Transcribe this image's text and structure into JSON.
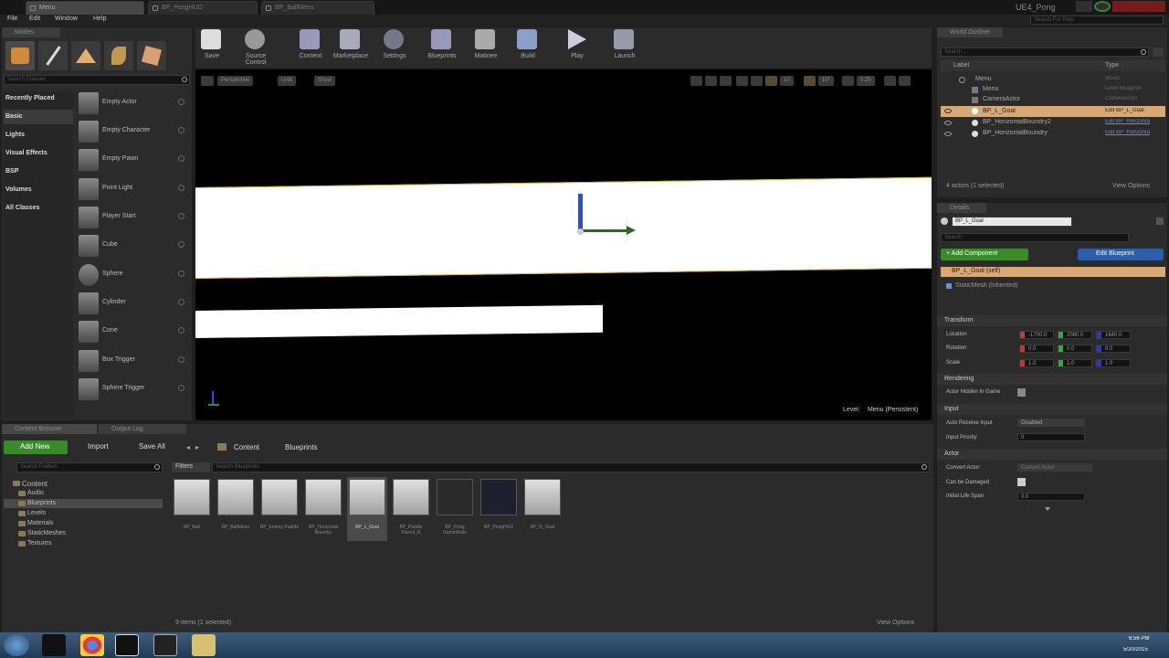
{
  "window": {
    "tabs": [
      "Menu",
      "BP_PongHUD",
      "BP_BallMenu"
    ],
    "app_name": "UE4_Pong",
    "help_placeholder": "Search For Help"
  },
  "menubar": [
    "File",
    "Edit",
    "Window",
    "Help"
  ],
  "modes": {
    "title": "Modes",
    "search_placeholder": "Search Classes",
    "categories": [
      "Recently Placed",
      "Basic",
      "Lights",
      "Visual Effects",
      "BSP",
      "Volumes",
      "All Classes"
    ],
    "items": [
      "Empty Actor",
      "Empty Character",
      "Empty Pawn",
      "Point Light",
      "Player Start",
      "Cube",
      "Sphere",
      "Cylinder",
      "Cone",
      "Box Trigger",
      "Sphere Trigger"
    ]
  },
  "toolbar": [
    "Save",
    "Source Control",
    "Content",
    "Marketplace",
    "Settings",
    "Blueprints",
    "Matinee",
    "Build",
    "Play",
    "Launch"
  ],
  "viewport": {
    "buttons": [
      "Perspective",
      "Unlit",
      "Show"
    ],
    "snap_values": [
      "10",
      "10°",
      "0.25"
    ],
    "level_label": "Level:",
    "level_name": "Menu (Persistent)"
  },
  "world_outliner": {
    "title": "World Outliner",
    "search_placeholder": "Search...",
    "col_label": "Label",
    "col_type": "Type",
    "rows": [
      {
        "label": "Menu",
        "type": "World"
      },
      {
        "label": "Menu",
        "type": "Level Blueprint"
      },
      {
        "label": "CameraActor",
        "type": "CameraActor"
      },
      {
        "label": "BP_L_Goal",
        "type": "Edit BP_L_Goal"
      },
      {
        "label": "BP_HorizontalBoundry2",
        "type": "Edit BP_Horizonta"
      },
      {
        "label": "BP_HorizontalBoundry",
        "type": "Edit BP_Horizonta"
      }
    ],
    "status": "4 actors (1 selected)",
    "view_options": "View Options"
  },
  "details": {
    "title": "Details",
    "name_value": "BP_L_Goal",
    "search_placeholder": "Search",
    "add_component": "+ Add Component",
    "edit_blueprint": "Edit Blueprint",
    "self_item": "BP_L_Goal (self)",
    "component": "StaticMesh (Inherited)",
    "sections": {
      "transform": "Transform",
      "rendering": "Rendering",
      "input": "Input",
      "actor": "Actor"
    },
    "location_label": "Location",
    "location": [
      "-1700.0",
      "2080.0",
      "1640.0"
    ],
    "rotation_label": "Rotation",
    "rotation": [
      "0.0",
      "0.0",
      "0.0"
    ],
    "scale_label": "Scale",
    "scale": [
      "1.0",
      "1.0",
      "1.0"
    ],
    "hidden_label": "Actor Hidden In Game",
    "auto_receive_label": "Auto Receive Input",
    "auto_receive_value": "Disabled",
    "input_priority_label": "Input Priority",
    "input_priority_value": "0",
    "convert_actor_label": "Convert Actor",
    "convert_actor_value": "Convert Actor",
    "can_damaged_label": "Can be Damaged",
    "life_span_label": "Initial Life Span",
    "life_span_value": "0.0"
  },
  "content_browser": {
    "tab1": "Content Browser",
    "tab2": "Output Log",
    "add_new": "Add New",
    "import": "Import",
    "save_all": "Save All",
    "path": [
      "Content",
      "Blueprints"
    ],
    "folder_search_placeholder": "Search Folders",
    "filters": "Filters",
    "asset_search_placeholder": "Search Blueprints",
    "folders": [
      "Content",
      "Audio",
      "Blueprints",
      "Levels",
      "Materials",
      "StaticMeshes",
      "Textures"
    ],
    "assets": [
      "BP_Ball",
      "BP_BallMenu",
      "BP_Enemy Paddle",
      "BP_Horizontal Boundry",
      "BP_L_Goal",
      "BP_Paddle Parent_R",
      "BP_Pong GameMode",
      "BP_PongHUD",
      "BP_R_Goal"
    ],
    "status": "9 items (1 selected)",
    "view_options": "View Options"
  },
  "taskbar": {
    "time": "6:56 PM",
    "date": "5/20/2015"
  }
}
